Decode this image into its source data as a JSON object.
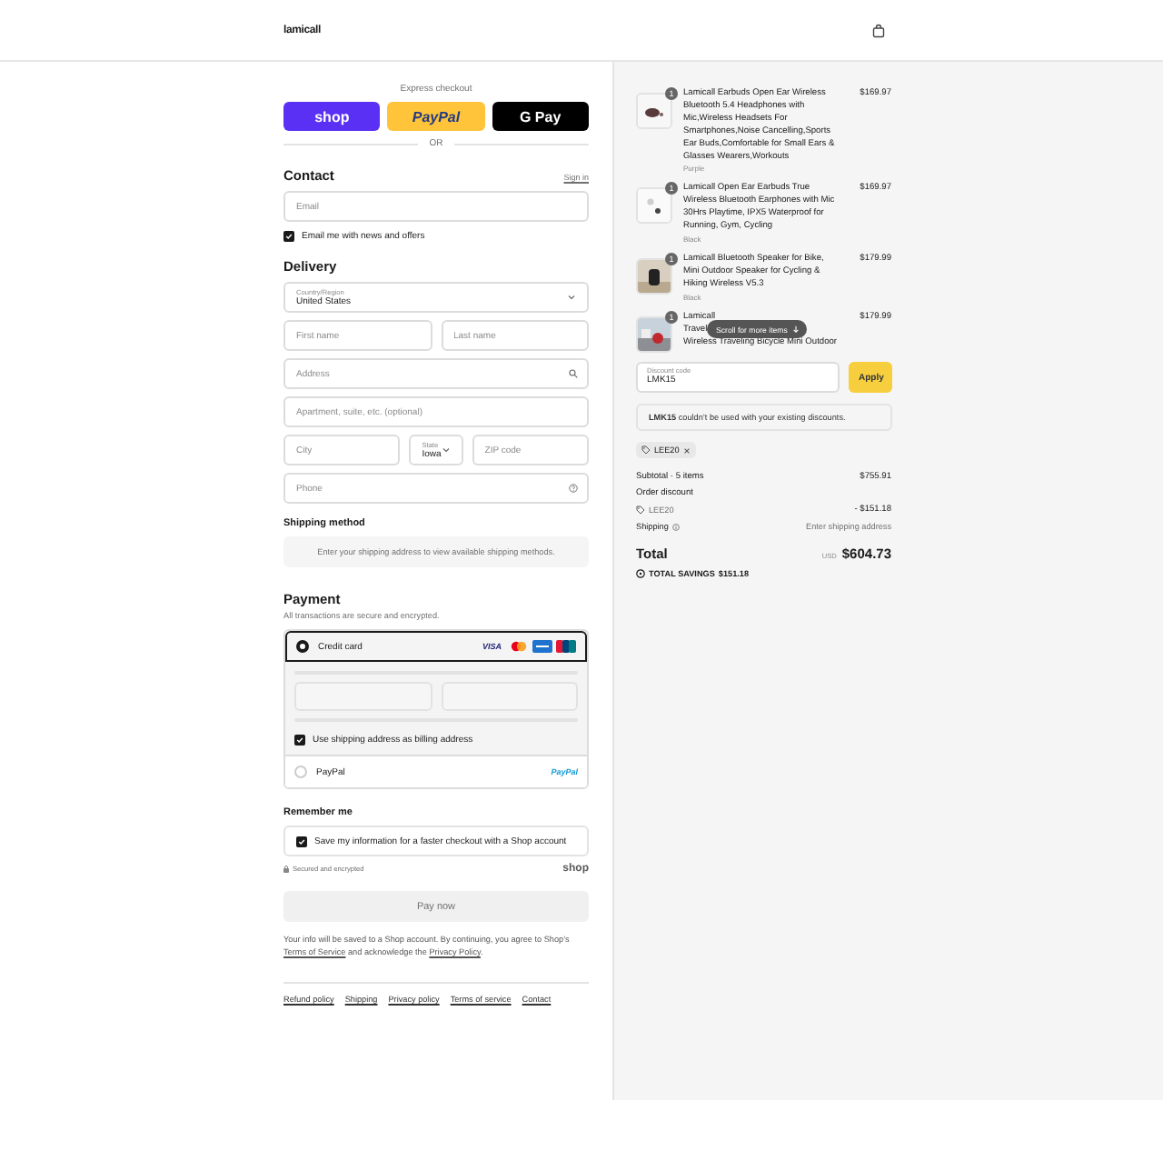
{
  "header": {
    "logo": "lamicall"
  },
  "express": {
    "label": "Express checkout",
    "divider": "OR",
    "buttons": [
      {
        "kind": "shop",
        "label": "shop"
      },
      {
        "kind": "paypal",
        "label": "PayPal"
      },
      {
        "kind": "gpay",
        "label": "G Pay"
      }
    ]
  },
  "contact": {
    "title": "Contact",
    "sign_in": "Sign in",
    "email": {
      "placeholder": "Email"
    },
    "newsletter": {
      "label": "Email me with news and offers",
      "checked": true
    }
  },
  "delivery": {
    "title": "Delivery",
    "rows": [
      [
        {
          "kind": "select",
          "label": "Country/Region",
          "value": "United States"
        }
      ],
      [
        {
          "kind": "text",
          "placeholder": "First name"
        },
        {
          "kind": "text",
          "placeholder": "Last name"
        }
      ],
      [
        {
          "kind": "search",
          "placeholder": "Address"
        }
      ],
      [
        {
          "kind": "text",
          "placeholder": "Apartment, suite, etc. (optional)"
        }
      ],
      [
        {
          "kind": "text",
          "placeholder": "City"
        },
        {
          "kind": "select",
          "label": "State",
          "value": "Iowa"
        },
        {
          "kind": "text",
          "placeholder": "ZIP code"
        }
      ],
      [
        {
          "kind": "help",
          "placeholder": "Phone"
        }
      ]
    ]
  },
  "shipping_method": {
    "title": "Shipping method",
    "notice": "Enter your shipping address to view available shipping methods."
  },
  "payment": {
    "title": "Payment",
    "subtitle": "All transactions are secure and encrypted.",
    "methods": [
      {
        "kind": "card",
        "label": "Credit card",
        "selected": true,
        "visa": "VISA",
        "billing": {
          "label": "Use shipping address as billing address",
          "checked": true
        }
      },
      {
        "kind": "paypal",
        "label": "PayPal",
        "selected": false,
        "logo": "PayPal"
      }
    ]
  },
  "remember": {
    "title": "Remember me",
    "save": {
      "label": "Save my information for a faster checkout with a Shop account",
      "checked": true
    },
    "secure": "Secured and encrypted",
    "shop_logo": "shop"
  },
  "pay_button": "Pay now",
  "legal": {
    "text_1": "Your info will be saved to a Shop account. By continuing, you agree to Shop’s",
    "link_1": "Terms of Service",
    "text_2": "and acknowledge the",
    "link_2": "Privacy Policy",
    "text_3": "."
  },
  "footer_links": [
    "Refund policy",
    "Shipping",
    "Privacy policy",
    "Terms of service",
    "Contact"
  ],
  "summary": {
    "items": [
      {
        "quantity": "1",
        "title": "Lamicall Earbuds Open Ear Wireless Bluetooth 5.4 Headphones with Mic,Wireless Headsets For Smartphones,Noise Cancelling,Sports Ear Buds,Comfortable for Small Ears & Glasses Wearers,Workouts",
        "variant": "Purple",
        "price": "$169.97"
      },
      {
        "quantity": "1",
        "title": "Lamicall Open Ear Earbuds True Wireless Bluetooth Earphones with Mic 30Hrs Playtime, IPX5 Waterproof for Running, Gym, Cycling",
        "variant": "Black",
        "price": "$169.97"
      },
      {
        "quantity": "1",
        "title": "Lamicall Bluetooth Speaker for Bike, Mini Outdoor Speaker for Cycling & Hiking Wireless V5.3",
        "variant": "Black",
        "price": "$179.99"
      },
      {
        "quantity": "1",
        "lines": [
          "Lamicall",
          "Travel",
          "Wireless Traveling Bicycle Mini Outdoor"
        ],
        "price": "$179.99"
      }
    ],
    "scroll_hint": "Scroll for more items",
    "discount": {
      "placeholder": "Discount code",
      "value": "LMK15",
      "button": "Apply"
    },
    "error": "**LMK15** couldn’t be used with your existing discounts.",
    "tag": "LEE20",
    "subtotal": {
      "label": "Subtotal · 5 items",
      "value": "$755.91"
    },
    "order_discount": {
      "label": "Order discount",
      "code": "LEE20",
      "value": "- $151.18"
    },
    "shipping": {
      "label": "Shipping",
      "value": "Enter shipping address"
    },
    "total": {
      "label": "Total",
      "currency": "USD",
      "value": "$604.73"
    },
    "savings": {
      "label": "TOTAL SAVINGS",
      "value": "$151.18"
    }
  }
}
